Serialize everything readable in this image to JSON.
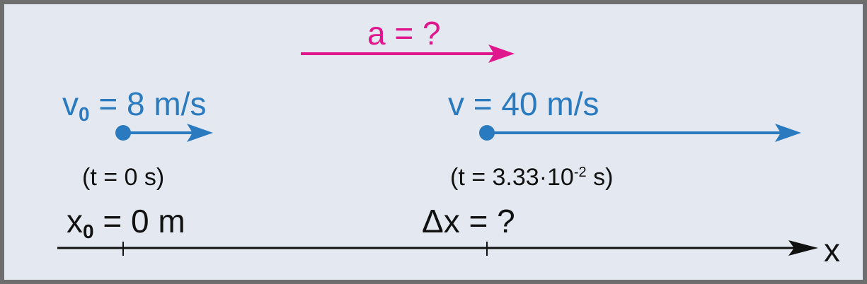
{
  "acceleration": {
    "label": "a = ?",
    "color": "#e0168c"
  },
  "initial": {
    "velocity_label": "v",
    "velocity_subscript": "0",
    "velocity_value": "= 8 m/s",
    "time_label": "(t = 0 s)",
    "position_label": "x",
    "position_subscript": "0",
    "position_value": "= 0 m"
  },
  "final": {
    "velocity_label": "v = 40 m/s",
    "time_label_main": "(t = 3.33·10",
    "time_label_exp": "-2",
    "time_label_end": " s)",
    "displacement_label": "Δx = ?"
  },
  "axis": {
    "label": "x"
  },
  "colors": {
    "velocity": "#2a7abf",
    "acceleration": "#e0168c",
    "axis": "#111111",
    "background": "#e4e8f0",
    "border": "#6e6e6e"
  }
}
